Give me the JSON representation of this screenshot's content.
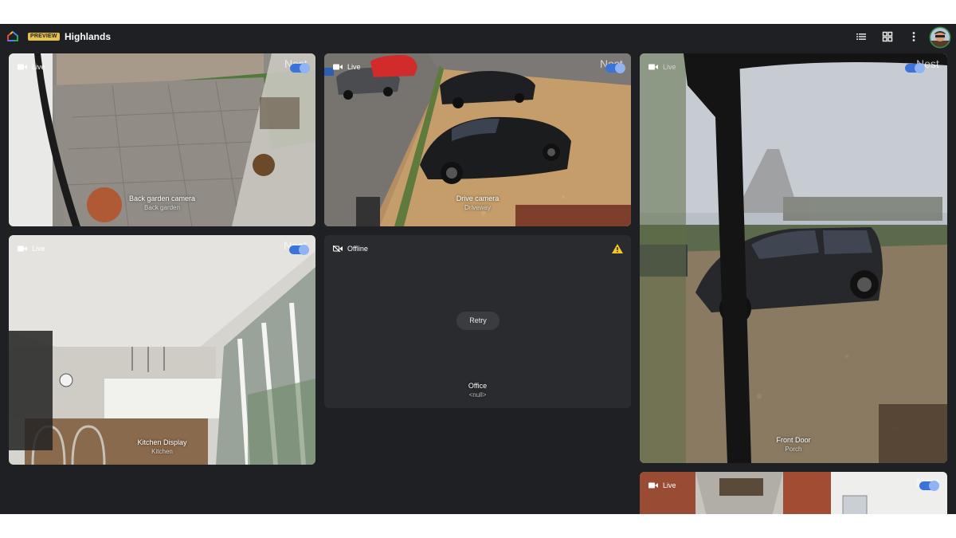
{
  "header": {
    "badge": "PREVIEW",
    "title": "Highlands",
    "icons": {
      "home": "google-home-icon",
      "list": "list-view-icon",
      "grid": "grid-view-icon",
      "more": "more-vert-icon",
      "avatar": "user-avatar"
    }
  },
  "cameras": [
    {
      "status": "Live",
      "name": "Back garden camera",
      "room": "Back garden",
      "watermark": "Nest"
    },
    {
      "status": "Live",
      "name": "Drive camera",
      "room": "Driveway",
      "watermark": "Nest"
    },
    {
      "status": "Live",
      "name": "Front Door",
      "room": "Porch",
      "watermark": "Nest"
    },
    {
      "status": "Live",
      "name": "Kitchen Display",
      "room": "Kitchen",
      "watermark": "Nest"
    },
    {
      "status": "Offline",
      "name": "Office",
      "room": "<null>",
      "retry_label": "Retry"
    },
    {
      "status": "Live",
      "watermark": "Nest"
    }
  ],
  "colors": {
    "background": "#1f2023",
    "tile": "#2a2b2f",
    "toggle": "#3b73d9",
    "badge": "#e6c14b",
    "warning": "#f4c430"
  }
}
